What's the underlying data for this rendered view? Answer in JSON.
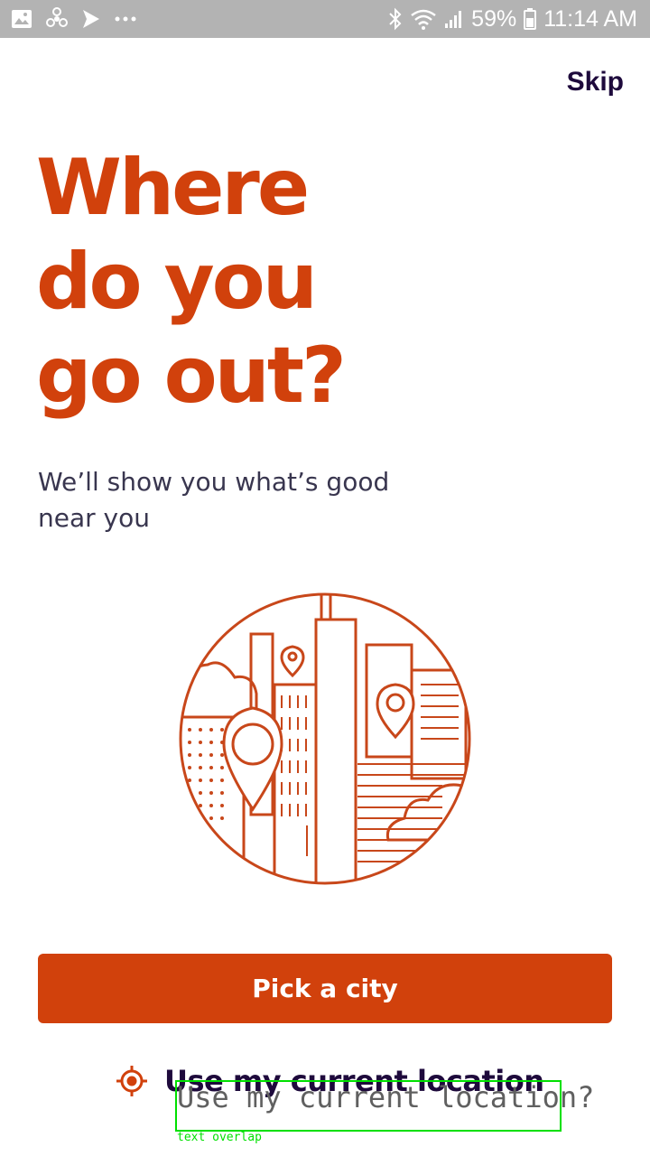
{
  "status_bar": {
    "battery": "59%",
    "time": "11:14 AM",
    "icons": [
      "gallery-icon",
      "fan-icon",
      "send-icon",
      "more-dots-icon",
      "bluetooth-icon",
      "wifi-icon",
      "signal-icon",
      "battery-icon"
    ]
  },
  "header": {
    "skip_label": "Skip"
  },
  "main": {
    "headline_lines": [
      "Where",
      "do you",
      "go out?"
    ],
    "subtitle": "We’ll show you what’s good near you",
    "illustration": "city-skyline-with-location-pins"
  },
  "actions": {
    "pick_city_label": "Pick a city",
    "use_location_label": "Use my current location",
    "location_icon": "target-icon"
  },
  "overlay": {
    "text": "Use my current location?",
    "tag": "text overlap",
    "color": "#00e000"
  },
  "colors": {
    "brand": "#d1410c",
    "heading_dark": "#1e0a3c",
    "body_text": "#39364f",
    "status_bar": "#b3b3b3"
  }
}
